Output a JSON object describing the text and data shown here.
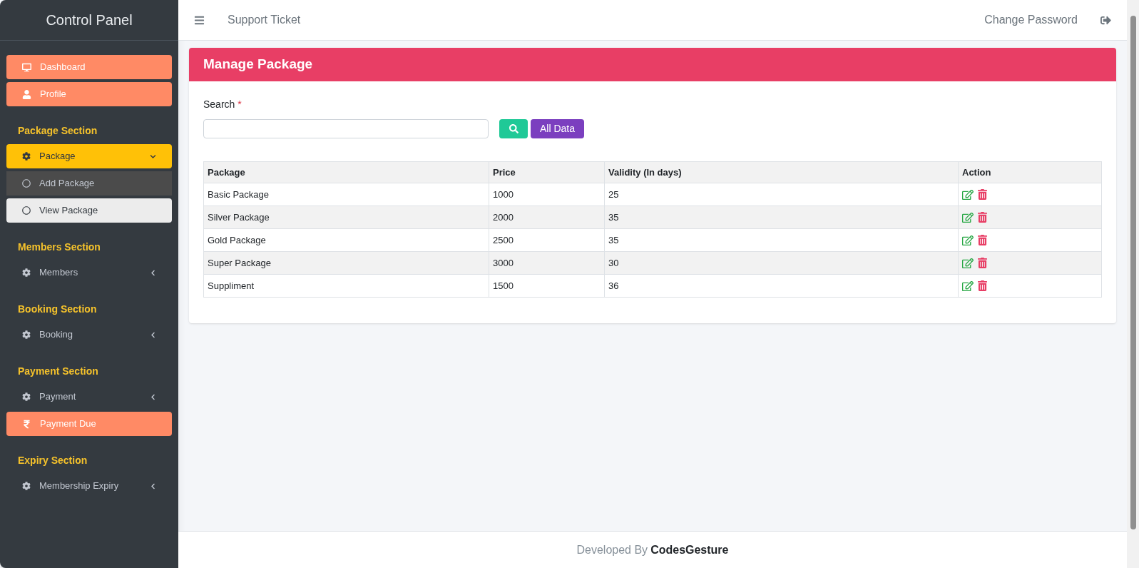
{
  "sidebar": {
    "title": "Control Panel",
    "links": [
      {
        "label": "Dashboard"
      },
      {
        "label": "Profile"
      }
    ],
    "sections": [
      {
        "title": "Package Section",
        "items": [
          {
            "kind": "menu",
            "label": "Package",
            "expanded": true,
            "children": [
              {
                "label": "Add Package",
                "selected": false
              },
              {
                "label": "View Package",
                "selected": true
              }
            ]
          }
        ]
      },
      {
        "title": "Members Section",
        "items": [
          {
            "kind": "menu",
            "label": "Members",
            "expanded": false
          }
        ]
      },
      {
        "title": "Booking Section",
        "items": [
          {
            "kind": "menu",
            "label": "Booking",
            "expanded": false
          }
        ]
      },
      {
        "title": "Payment Section",
        "items": [
          {
            "kind": "menu",
            "label": "Payment",
            "expanded": false
          },
          {
            "kind": "link",
            "label": "Payment Due"
          }
        ]
      },
      {
        "title": "Expiry Section",
        "items": [
          {
            "kind": "menu",
            "label": "Membership Expiry",
            "expanded": false
          }
        ]
      }
    ]
  },
  "topbar": {
    "link": "Support Ticket",
    "right_link": "Change Password"
  },
  "card": {
    "title": "Manage Package",
    "search_label": "Search",
    "required_mark": "*",
    "all_button": "All Data"
  },
  "table": {
    "columns": [
      "Package",
      "Price",
      "Validity (In days)",
      "Action"
    ],
    "rows": [
      [
        "Basic Package",
        "1000",
        "25"
      ],
      [
        "Silver Package",
        "2000",
        "35"
      ],
      [
        "Gold Package",
        "2500",
        "35"
      ],
      [
        "Super Package",
        "3000",
        "30"
      ],
      [
        "Suppliment",
        "1500",
        "36"
      ]
    ]
  },
  "footer": {
    "text": "Developed By",
    "brand": "CodesGesture"
  }
}
